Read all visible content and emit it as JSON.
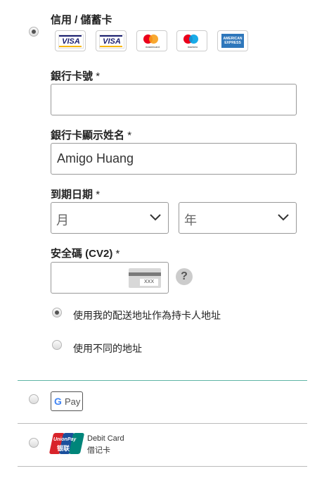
{
  "card_section": {
    "title": "信用 / 儲蓄卡",
    "brands": [
      {
        "icon": "visa-icon",
        "text": "VISA"
      },
      {
        "icon": "visa-electron-icon",
        "text": "VISA",
        "sub": "Electron"
      },
      {
        "icon": "mastercard-icon",
        "sub": "mastercard"
      },
      {
        "icon": "maestro-icon",
        "sub": "maestro"
      },
      {
        "icon": "amex-icon",
        "text_lines": [
          "AMERICAN",
          "EXPRESS"
        ]
      }
    ]
  },
  "card_number": {
    "label": "銀行卡號",
    "value": ""
  },
  "cardholder": {
    "label": "銀行卡顯示姓名",
    "value": "Amigo Huang"
  },
  "expiry": {
    "label": "到期日期",
    "month_placeholder": "月",
    "year_placeholder": "年"
  },
  "cvv": {
    "label": "安全碼 (CV2)",
    "value": "",
    "card_hint": "XXX",
    "help": "?"
  },
  "required_mark": "*",
  "address_options": [
    {
      "label": "使用我的配送地址作為持卡人地址",
      "selected": true
    },
    {
      "label": "使用不同的地址",
      "selected": false
    }
  ],
  "gpay": {
    "text": "Pay",
    "logo_letter": "G"
  },
  "unionpay": {
    "logo_text_1": "UnionPay",
    "logo_text_2": "银联",
    "label_line1": "Debit Card",
    "label_line2": "借记卡"
  },
  "colors": {
    "divider_teal": "#5fb5a5",
    "divider_gray": "#bbbbbb",
    "visa_blue": "#1a1f71",
    "mc_red": "#eb001b",
    "mc_orange": "#f79e1b",
    "maestro_blue": "#00a2e5",
    "amex_blue": "#2e77bb"
  }
}
